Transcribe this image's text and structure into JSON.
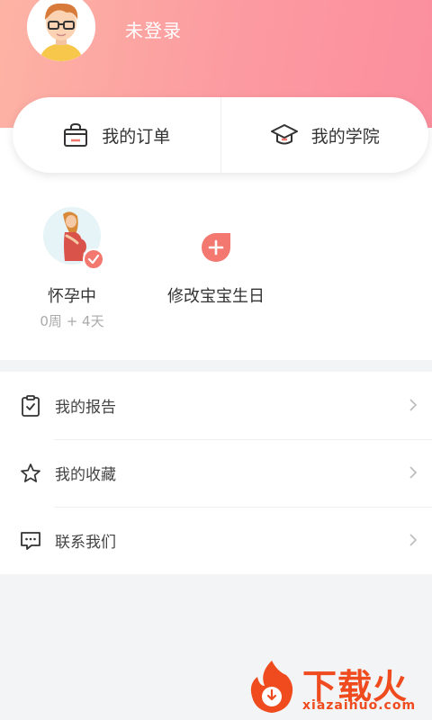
{
  "header": {
    "login_status": "未登录"
  },
  "shortcuts": [
    {
      "label": "我的订单",
      "icon": "shopping-bag-icon"
    },
    {
      "label": "我的学院",
      "icon": "graduation-cap-icon"
    }
  ],
  "status": {
    "pregnancy_label": "怀孕中",
    "pregnancy_progress": "0周 + 4天",
    "edit_birthday_label": "修改宝宝生日"
  },
  "menu": [
    {
      "label": "我的报告",
      "icon": "clipboard-check-icon"
    },
    {
      "label": "我的收藏",
      "icon": "star-icon"
    },
    {
      "label": "联系我们",
      "icon": "chat-icon"
    }
  ],
  "watermark": {
    "brand": "下载火",
    "url": "xiazaihuo.com"
  },
  "colors": {
    "header_gradient_start": "#fdb3a4",
    "header_gradient_end": "#fb8e9d",
    "accent": "#f3786f",
    "watermark": "#ef4b1e"
  }
}
